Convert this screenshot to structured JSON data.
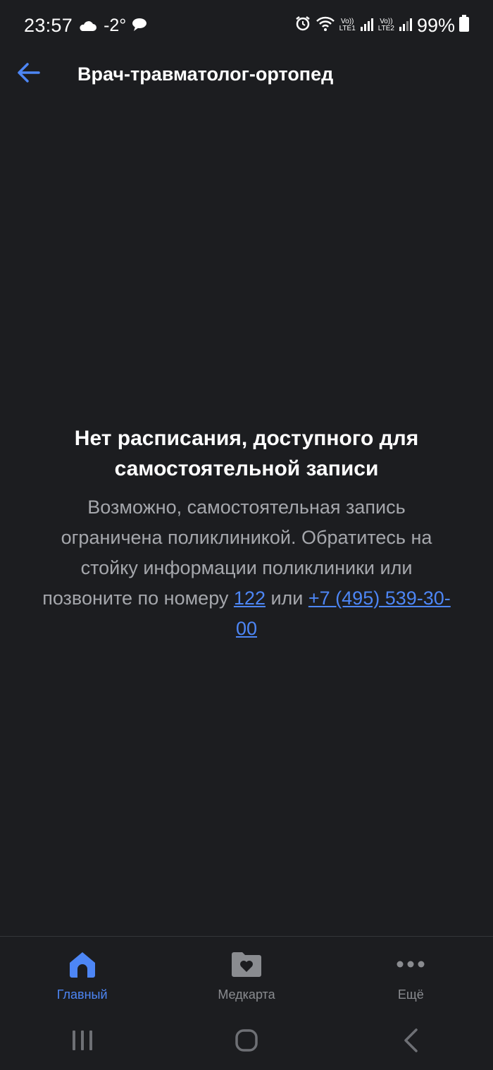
{
  "status_bar": {
    "time": "23:57",
    "temperature": "-2°",
    "lte1": "LTE1",
    "lte2": "LTE2",
    "volte": "Vo))",
    "battery": "99%"
  },
  "app_bar": {
    "title": "Врач-травматолог-ортопед",
    "back_icon": "arrow-left-icon"
  },
  "empty_state": {
    "title": "Нет расписания, доступного для самостоятельной записи",
    "text_before": "Возможно, самостоятельная запись ограничена поликлиникой. Обратитесь на стойку информации поликлиники или позвоните по номеру ",
    "phone_short": "122",
    "text_between": " или ",
    "phone_full": "+7 (495) 539-30-00"
  },
  "bottom_nav": {
    "items": [
      {
        "label": "Главный",
        "icon": "home-icon",
        "active": true
      },
      {
        "label": "Медкарта",
        "icon": "medcard-folder-icon",
        "active": false
      },
      {
        "label": "Ещё",
        "icon": "more-dots-icon",
        "active": false
      }
    ]
  },
  "colors": {
    "background": "#1c1d20",
    "accent": "#4d86f5",
    "muted_text": "#a5a7ac",
    "inactive_icon": "#8a8c90"
  }
}
